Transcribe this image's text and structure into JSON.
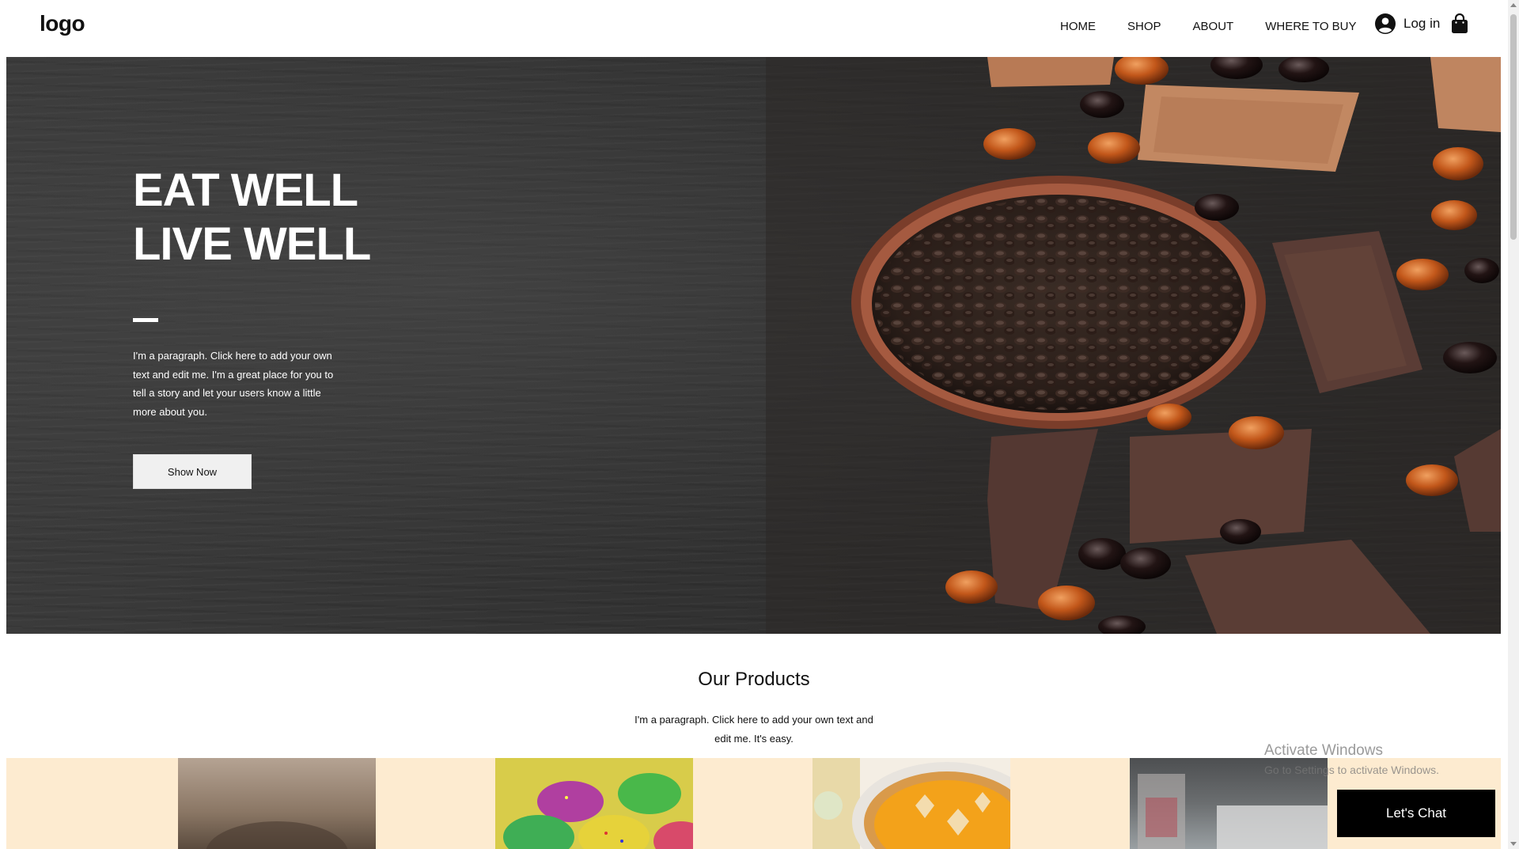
{
  "header": {
    "logo": "logo",
    "nav": [
      {
        "label": "HOME"
      },
      {
        "label": "SHOP"
      },
      {
        "label": "ABOUT"
      },
      {
        "label": "WHERE TO BUY"
      }
    ],
    "login_label": "Log in",
    "login_icon": "account-circle-icon",
    "cart_icon": "shopping-bag-icon"
  },
  "hero": {
    "title_line1": "EAT WELL",
    "title_line2": "LIVE WELL",
    "paragraph": "I'm a paragraph. Click here to add your own text and edit me. I'm a great place for you to tell a story and let your users know a little more about you.",
    "button_label": "Show Now"
  },
  "products": {
    "title": "Our Products",
    "paragraph": "I'm a paragraph. Click here to add your own text and edit me. It's easy."
  },
  "watermark": {
    "line1": "Activate Windows",
    "line2": "Go to Settings to activate Windows."
  },
  "chat": {
    "label": "Let's Chat"
  },
  "colors": {
    "strip_background": "#fdebd0",
    "chat_background": "#000000",
    "hero_background": "#333333"
  }
}
